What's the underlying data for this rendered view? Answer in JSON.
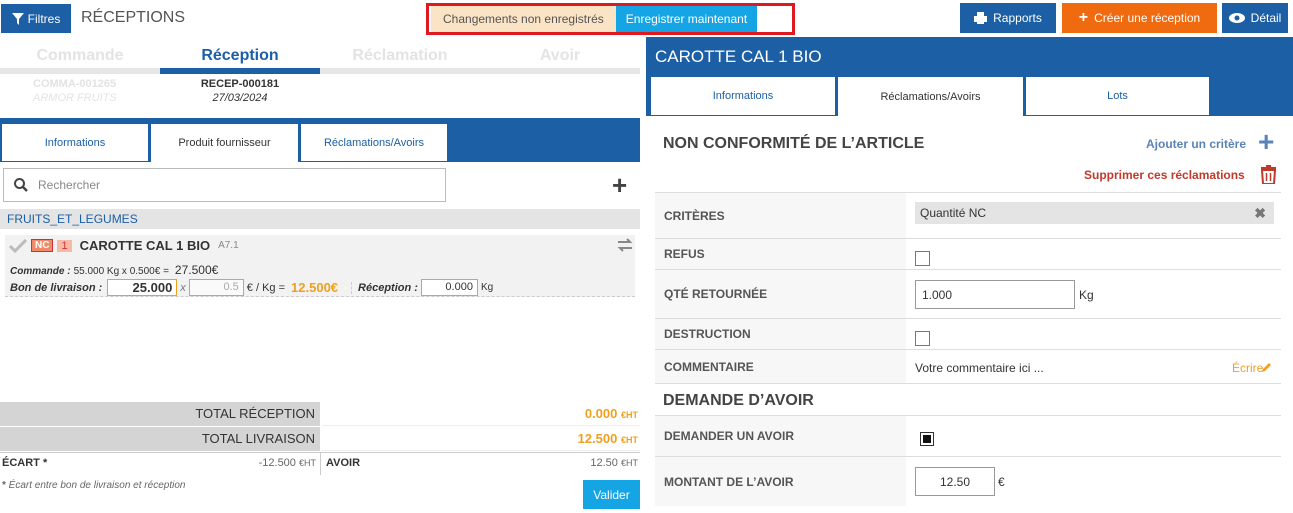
{
  "header": {
    "filters_label": "Filtres",
    "page_title": "RÉCEPTIONS",
    "unsaved_label": "Changements non enregistrés",
    "save_now_label": "Enregistrer maintenant",
    "reports_label": "Rapports",
    "create_label": "Créer une réception",
    "detail_label": "Détail"
  },
  "steps": [
    {
      "name": "Commande",
      "code": "COMMA-001265",
      "sub": "ARMOR FRUITS"
    },
    {
      "name": "Réception",
      "code": "RECEP-000181",
      "sub": "27/03/2024"
    },
    {
      "name": "Réclamation",
      "code": "",
      "sub": ""
    },
    {
      "name": "Avoir",
      "code": "",
      "sub": ""
    }
  ],
  "left_tabs": [
    "Informations",
    "Produit fournisseur",
    "Réclamations/Avoirs"
  ],
  "search": {
    "placeholder": "Rechercher"
  },
  "category": "FRUITS_ET_LEGUMES",
  "product": {
    "nc": "NC",
    "nc_count": "1",
    "name": "CAROTTE CAL 1 BIO",
    "code": "A7.1",
    "order_label": "Commande :",
    "order_detail": "55.000 Kg x  0.500€ =",
    "order_total": "27.500€",
    "delivery_label": "Bon de livraison :",
    "delivery_qty": "25.000",
    "x": "x",
    "unit_price": "0.5",
    "price_unit": "€ / Kg =",
    "delivery_total": "12.500€",
    "reception_label": "Réception :",
    "reception_qty": "0.000",
    "reception_unit": "Kg"
  },
  "totals": {
    "reception_label": "TOTAL RÉCEPTION",
    "reception_value": "0.000",
    "livraison_label": "TOTAL LIVRAISON",
    "livraison_value": "12.500",
    "unit": "€HT",
    "ecart_label": "ÉCART *",
    "ecart_value": "-12.500",
    "avoir_label": "AVOIR",
    "avoir_value": "12.50",
    "footnote": "Écart entre bon de livraison et réception",
    "validate_label": "Valider"
  },
  "right": {
    "title": "CAROTTE CAL 1 BIO",
    "tabs": [
      "Informations",
      "Réclamations/Avoirs",
      "Lots"
    ],
    "nc_title": "NON CONFORMITÉ DE L’ARTICLE",
    "add_criterion": "Ajouter un critère",
    "delete_claims": "Supprimer ces réclamations",
    "criteres_label": "CRITÈRES",
    "criteres_value": "Quantité NC",
    "refus_label": "REFUS",
    "qte_label": "QTÉ RETOURNÉE",
    "qte_value": "1.000",
    "qte_unit": "Kg",
    "destruction_label": "DESTRUCTION",
    "comment_label": "COMMENTAIRE",
    "comment_placeholder": "Votre commentaire ici ...",
    "write_label": "Écrire",
    "credit_title": "DEMANDE D’AVOIR",
    "ask_credit_label": "DEMANDER UN AVOIR",
    "amount_label": "MONTANT DE L’AVOIR",
    "amount_value": "12.50",
    "amount_unit": "€"
  },
  "colors": {
    "primary": "#1c5fa5",
    "accent": "#f06a0f",
    "highlight": "#15a5e5",
    "warning": "#f0a020",
    "danger": "#c0392b"
  }
}
